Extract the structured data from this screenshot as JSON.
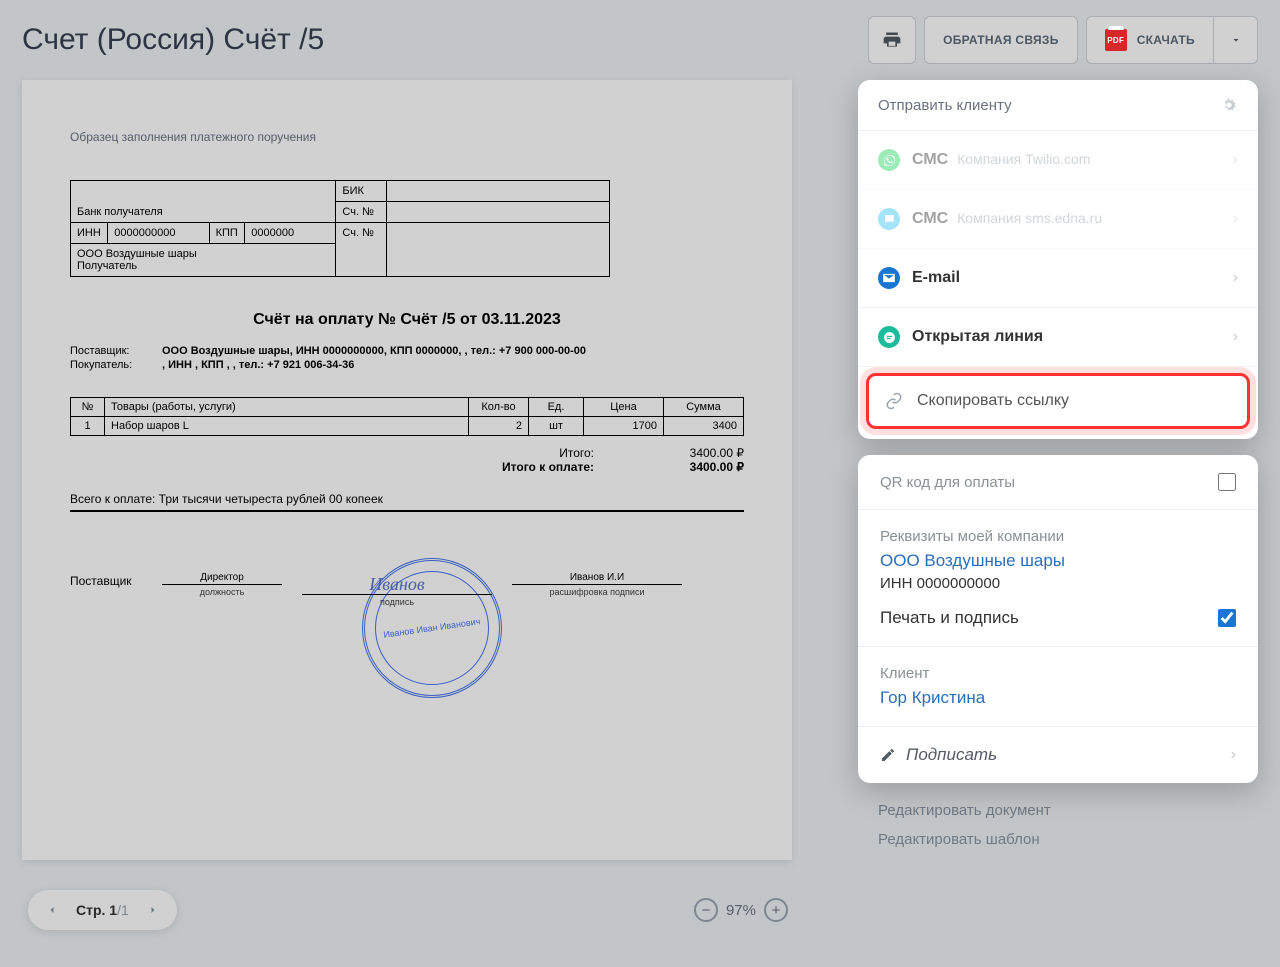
{
  "header": {
    "title": "Счет (Россия) Счёт /5",
    "feedback": "ОБРАТНАЯ СВЯЗЬ",
    "download": "СКАЧАТЬ",
    "pdf_badge": "PDF"
  },
  "document": {
    "fill_sample": "Образец заполнения платежного поручения",
    "bank": {
      "bank_recipient": "Банк получателя",
      "bik": "БИК",
      "acct_no": "Сч. №",
      "inn_label": "ИНН",
      "inn": "0000000000",
      "kpp_label": "КПП",
      "kpp": "0000000",
      "acct_no2": "Сч. №",
      "company": "ООО Воздушные шары",
      "recipient": "Получатель"
    },
    "title": "Счёт на оплату № Счёт /5 от 03.11.2023",
    "supplier_label": "Поставщик:",
    "supplier_value": "ООО Воздушные шары, ИНН 0000000000, КПП 0000000, , тел.: +7 900 000-00-00",
    "buyer_label": "Покупатель:",
    "buyer_value": ", ИНН , КПП , , тел.: +7 921 006-34-36",
    "items": {
      "headers": {
        "no": "№",
        "name": "Товары (работы, услуги)",
        "qty": "Кол-во",
        "unit": "Ед.",
        "price": "Цена",
        "sum": "Сумма"
      },
      "rows": [
        {
          "no": "1",
          "name": "Набор шаров L",
          "qty": "2",
          "unit": "шт",
          "price": "1700",
          "sum": "3400"
        }
      ]
    },
    "totals": {
      "subtotal_label": "Итого:",
      "subtotal": "3400.00 ₽",
      "grand_label": "Итого к оплате:",
      "grand": "3400.00 ₽"
    },
    "sum_words": "Всего к оплате: Три тысячи четыреста рублей 00 копеек",
    "sign": {
      "supplier": "Поставщик",
      "pos": "Директор",
      "pos_sub": "должность",
      "sig_sub": "подпись",
      "name": "Иванов И.И",
      "name_sub": "расшифровка подписи",
      "stamp_text": "Иванов Иван Иванович"
    }
  },
  "pager": {
    "label": "Стр. 1/1",
    "zoom": "97%"
  },
  "send": {
    "title": "Отправить клиенту",
    "options": {
      "sms1": {
        "label": "СМС",
        "sub": "Компания Twilio.com",
        "icon": "whatsapp-icon"
      },
      "sms2": {
        "label": "СМС",
        "sub": "Компания sms.edna.ru",
        "icon": "chat-bubble-icon"
      },
      "email": {
        "label": "E-mail"
      },
      "openline": {
        "label": "Открытая линия"
      },
      "copylink": {
        "label": "Скопировать ссылку"
      }
    }
  },
  "panel": {
    "qr": "QR код для оплаты",
    "req_title": "Реквизиты моей компании",
    "req_company": "ООО Воздушные шары",
    "req_inn": "ИНН 0000000000",
    "stamp_sign": "Печать и подпись",
    "client_title": "Клиент",
    "client_name": "Гор Кристина",
    "sign_action": "Подписать"
  },
  "links": {
    "edit_doc": "Редактировать документ",
    "edit_tpl": "Редактировать шаблон"
  }
}
